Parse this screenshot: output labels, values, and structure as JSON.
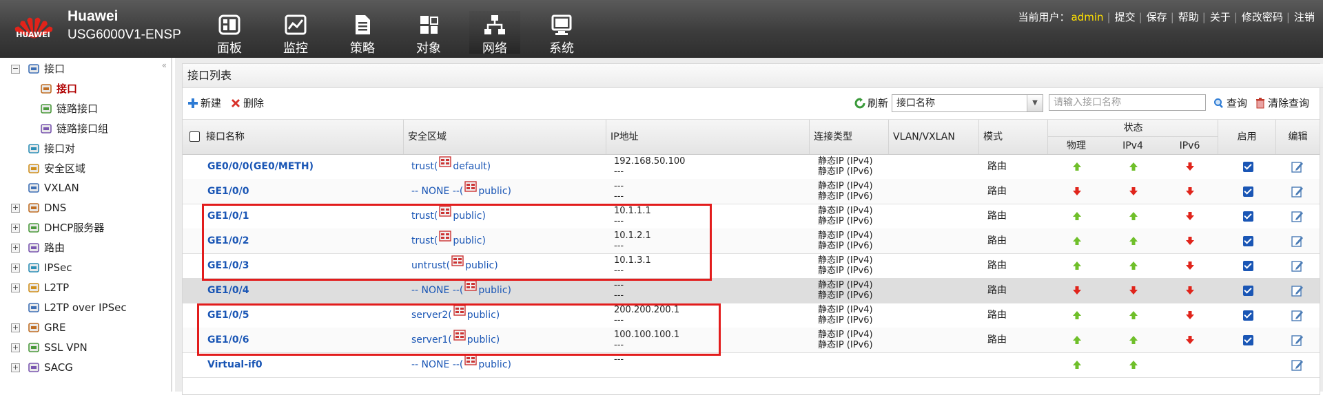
{
  "header": {
    "brand_name": "Huawei",
    "brand_model": "USG6000V1-ENSP",
    "logo_text": "HUAWEI",
    "nav": [
      {
        "label": "面板",
        "icon": "dashboard-icon"
      },
      {
        "label": "监控",
        "icon": "monitor-icon"
      },
      {
        "label": "策略",
        "icon": "policy-icon"
      },
      {
        "label": "对象",
        "icon": "object-icon"
      },
      {
        "label": "网络",
        "icon": "network-icon"
      },
      {
        "label": "系统",
        "icon": "system-icon"
      }
    ],
    "active_nav": "网络",
    "user_label": "当前用户：",
    "username": "admin",
    "links": [
      "提交",
      "保存",
      "帮助",
      "关于",
      "修改密码",
      "注销"
    ]
  },
  "sidebar": {
    "items": [
      {
        "label": "接口",
        "level": 0,
        "expander": "−",
        "icon": "interface-icon"
      },
      {
        "label": "接口",
        "level": 1,
        "active": true,
        "icon": "interface-icon"
      },
      {
        "label": "链路接口",
        "level": 1,
        "icon": "link-interface-icon"
      },
      {
        "label": "链路接口组",
        "level": 1,
        "icon": "link-group-icon"
      },
      {
        "label": "接口对",
        "level": 0,
        "icon": "interface-pair-icon"
      },
      {
        "label": "安全区域",
        "level": 0,
        "icon": "security-zone-icon"
      },
      {
        "label": "VXLAN",
        "level": 0,
        "icon": "vxlan-icon"
      },
      {
        "label": "DNS",
        "level": 0,
        "expander": "+",
        "icon": "dns-icon"
      },
      {
        "label": "DHCP服务器",
        "level": 0,
        "expander": "+",
        "icon": "dhcp-icon"
      },
      {
        "label": "路由",
        "level": 0,
        "expander": "+",
        "icon": "route-icon"
      },
      {
        "label": "IPSec",
        "level": 0,
        "expander": "+",
        "icon": "ipsec-icon"
      },
      {
        "label": "L2TP",
        "level": 0,
        "expander": "+",
        "icon": "l2tp-icon"
      },
      {
        "label": "L2TP over IPSec",
        "level": 0,
        "icon": "l2tp-ipsec-icon"
      },
      {
        "label": "GRE",
        "level": 0,
        "expander": "+",
        "icon": "gre-icon"
      },
      {
        "label": "SSL VPN",
        "level": 0,
        "expander": "+",
        "icon": "ssl-vpn-icon"
      },
      {
        "label": "SACG",
        "level": 0,
        "expander": "+",
        "icon": "sacg-icon"
      }
    ]
  },
  "main": {
    "title": "接口列表",
    "toolbar": {
      "new_label": "新建",
      "delete_label": "删除",
      "refresh_label": "刷新",
      "search_field": "接口名称",
      "search_placeholder": "请输入接口名称",
      "query_label": "查询",
      "clear_label": "清除查询"
    },
    "columns": {
      "name": "接口名称",
      "zone": "安全区域",
      "ip": "IP地址",
      "conn_type": "连接类型",
      "vlan": "VLAN/VXLAN",
      "mode": "模式",
      "status": "状态",
      "status_sub": [
        "物理",
        "IPv4",
        "IPv6"
      ],
      "enable": "启用",
      "edit": "编辑"
    },
    "rows": [
      {
        "name": "GE0/0/0(GE0/METH)",
        "zone_prefix": "trust(",
        "zone_vsys": "default)",
        "vsys_icon": "virtual-system-icon",
        "ip1": "192.168.50.100",
        "ip2": "---",
        "conn1": "静态IP (IPv4)",
        "conn2": "静态IP (IPv6)",
        "mode": "路由",
        "phys": "up",
        "ipv4": "up",
        "ipv6": "down",
        "enabled": true
      },
      {
        "name": "GE1/0/0",
        "zone_prefix": "-- NONE --(",
        "zone_vsys": "public)",
        "vsys_icon": "public-system-icon",
        "ip1": "---",
        "ip2": "---",
        "conn1": "静态IP (IPv4)",
        "conn2": "静态IP (IPv6)",
        "mode": "路由",
        "phys": "down",
        "ipv4": "down",
        "ipv6": "down",
        "enabled": true
      },
      {
        "name": "GE1/0/1",
        "zone_prefix": "trust(",
        "zone_vsys": "public)",
        "vsys_icon": "public-system-icon",
        "ip1": "10.1.1.1",
        "ip2": "---",
        "conn1": "静态IP (IPv4)",
        "conn2": "静态IP (IPv6)",
        "mode": "路由",
        "phys": "up",
        "ipv4": "up",
        "ipv6": "down",
        "enabled": true
      },
      {
        "name": "GE1/0/2",
        "zone_prefix": "trust(",
        "zone_vsys": "public)",
        "vsys_icon": "public-system-icon",
        "ip1": "10.1.2.1",
        "ip2": "---",
        "conn1": "静态IP (IPv4)",
        "conn2": "静态IP (IPv6)",
        "mode": "路由",
        "phys": "up",
        "ipv4": "up",
        "ipv6": "down",
        "enabled": true
      },
      {
        "name": "GE1/0/3",
        "zone_prefix": "untrust(",
        "zone_vsys": "public)",
        "vsys_icon": "public-system-icon",
        "ip1": "10.1.3.1",
        "ip2": "---",
        "conn1": "静态IP (IPv4)",
        "conn2": "静态IP (IPv6)",
        "mode": "路由",
        "phys": "up",
        "ipv4": "up",
        "ipv6": "down",
        "enabled": true
      },
      {
        "name": "GE1/0/4",
        "zone_prefix": "-- NONE --(",
        "zone_vsys": "public)",
        "vsys_icon": "public-system-icon",
        "ip1": "---",
        "ip2": "---",
        "conn1": "静态IP (IPv4)",
        "conn2": "静态IP (IPv6)",
        "mode": "路由",
        "phys": "down",
        "ipv4": "down",
        "ipv6": "down",
        "enabled": true,
        "highlighted": true
      },
      {
        "name": "GE1/0/5",
        "zone_prefix": "server2(",
        "zone_vsys": "public)",
        "vsys_icon": "public-system-icon",
        "ip1": "200.200.200.1",
        "ip2": "---",
        "conn1": "静态IP (IPv4)",
        "conn2": "静态IP (IPv6)",
        "mode": "路由",
        "phys": "up",
        "ipv4": "up",
        "ipv6": "down",
        "enabled": true
      },
      {
        "name": "GE1/0/6",
        "zone_prefix": "server1(",
        "zone_vsys": "public)",
        "vsys_icon": "public-system-icon",
        "ip1": "100.100.100.1",
        "ip2": "---",
        "conn1": "静态IP (IPv4)",
        "conn2": "静态IP (IPv6)",
        "mode": "路由",
        "phys": "up",
        "ipv4": "up",
        "ipv6": "down",
        "enabled": true
      },
      {
        "name": "Virtual-if0",
        "zone_prefix": "-- NONE --(",
        "zone_vsys": "public)",
        "vsys_icon": "public-system-icon",
        "ip1": "---",
        "ip2": "",
        "conn1": "",
        "conn2": "",
        "mode": "",
        "phys": "up",
        "ipv4": "up",
        "ipv6": null,
        "enabled": null
      }
    ]
  },
  "colors": {
    "arrow_up": "#6fbf2a",
    "arrow_down": "#e0241b",
    "link": "#1a56b5",
    "annotation_box": "#e21c1c",
    "active_nav_text": "#ffffff"
  }
}
